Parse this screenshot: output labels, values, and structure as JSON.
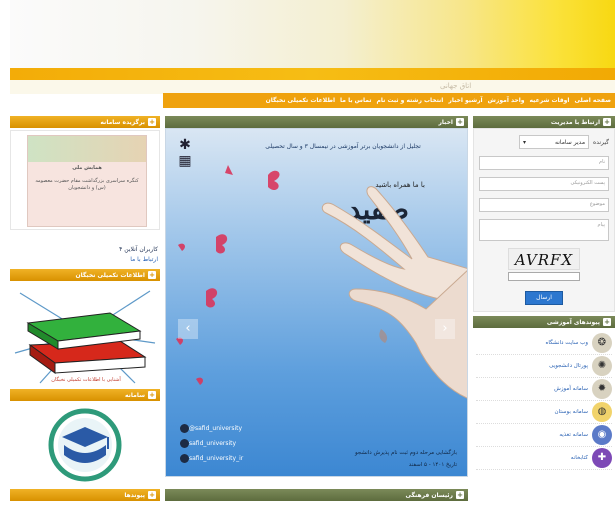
{
  "header": {
    "faint_text": "اتاق جهانی"
  },
  "nav": {
    "items": [
      "صفحه اصلی",
      "اوقات شرعیه",
      "واحد آموزش",
      "آرشیو اخبار",
      "انتخاب رشته و ثبت نام",
      "تماس با ما",
      "اطلاعات تکمیلی نخبگان"
    ]
  },
  "left": {
    "sec1_title": "برگزیده سامانه",
    "thumb_heading": "همایش ملی",
    "thumb_text": "کنگره سراسری بزرگداشت مقام حضرت معصومه (س) و دانشجویان",
    "counter": "کاربران آنلاین ۴",
    "counter_link": "ارتباط با ما",
    "sec2_title": "اطلاعات تکمیلی نخبگان",
    "book_caption": "آشنایی با اطلاعات تکمیلی نخبگان",
    "sec3_title": "سامانه",
    "sec4_title": "پیوندها"
  },
  "center": {
    "title": "اخبار",
    "caption": "تجلیل از دانشجویان برتر آموزشی در نیمسال ۳ و سال تحصیلی",
    "subtitle": "با ما همراه باشید",
    "big_title": "صفید",
    "social": [
      "@safid_university",
      "safid_university",
      "safid_university_ir"
    ],
    "footer_text": "بازگشایی مرحله دوم ثبت نام پذیرش دانشجو",
    "footer_date": "تاریخ ۱۴۰۱ - ۵ اسفند",
    "next_section": "رئیسان فرهنگی"
  },
  "right": {
    "title": "ارتباط با مدیریت",
    "to_label": "گیرنده",
    "to_value": "مدیر سامانه",
    "name_placeholder": "نام",
    "email_placeholder": "پست الکترونیکی",
    "subject_placeholder": "موضوع",
    "message_placeholder": "پیام",
    "captcha_text": "AVRFX",
    "send_label": "ارسال",
    "links_title": "پیوندهای آموزشی",
    "links": [
      {
        "label": "وب سایت دانشگاه",
        "icon": "university-seal-icon"
      },
      {
        "label": "پورتال دانشجویی",
        "icon": "emblem-icon"
      },
      {
        "label": "سامانه آموزش",
        "icon": "seal-icon"
      },
      {
        "label": "سامانه بوستان",
        "icon": "globe-icon"
      },
      {
        "label": "سامانه تغذیه",
        "icon": "badge-icon"
      },
      {
        "label": "کتابخانه",
        "icon": "puzzle-icon"
      }
    ]
  }
}
